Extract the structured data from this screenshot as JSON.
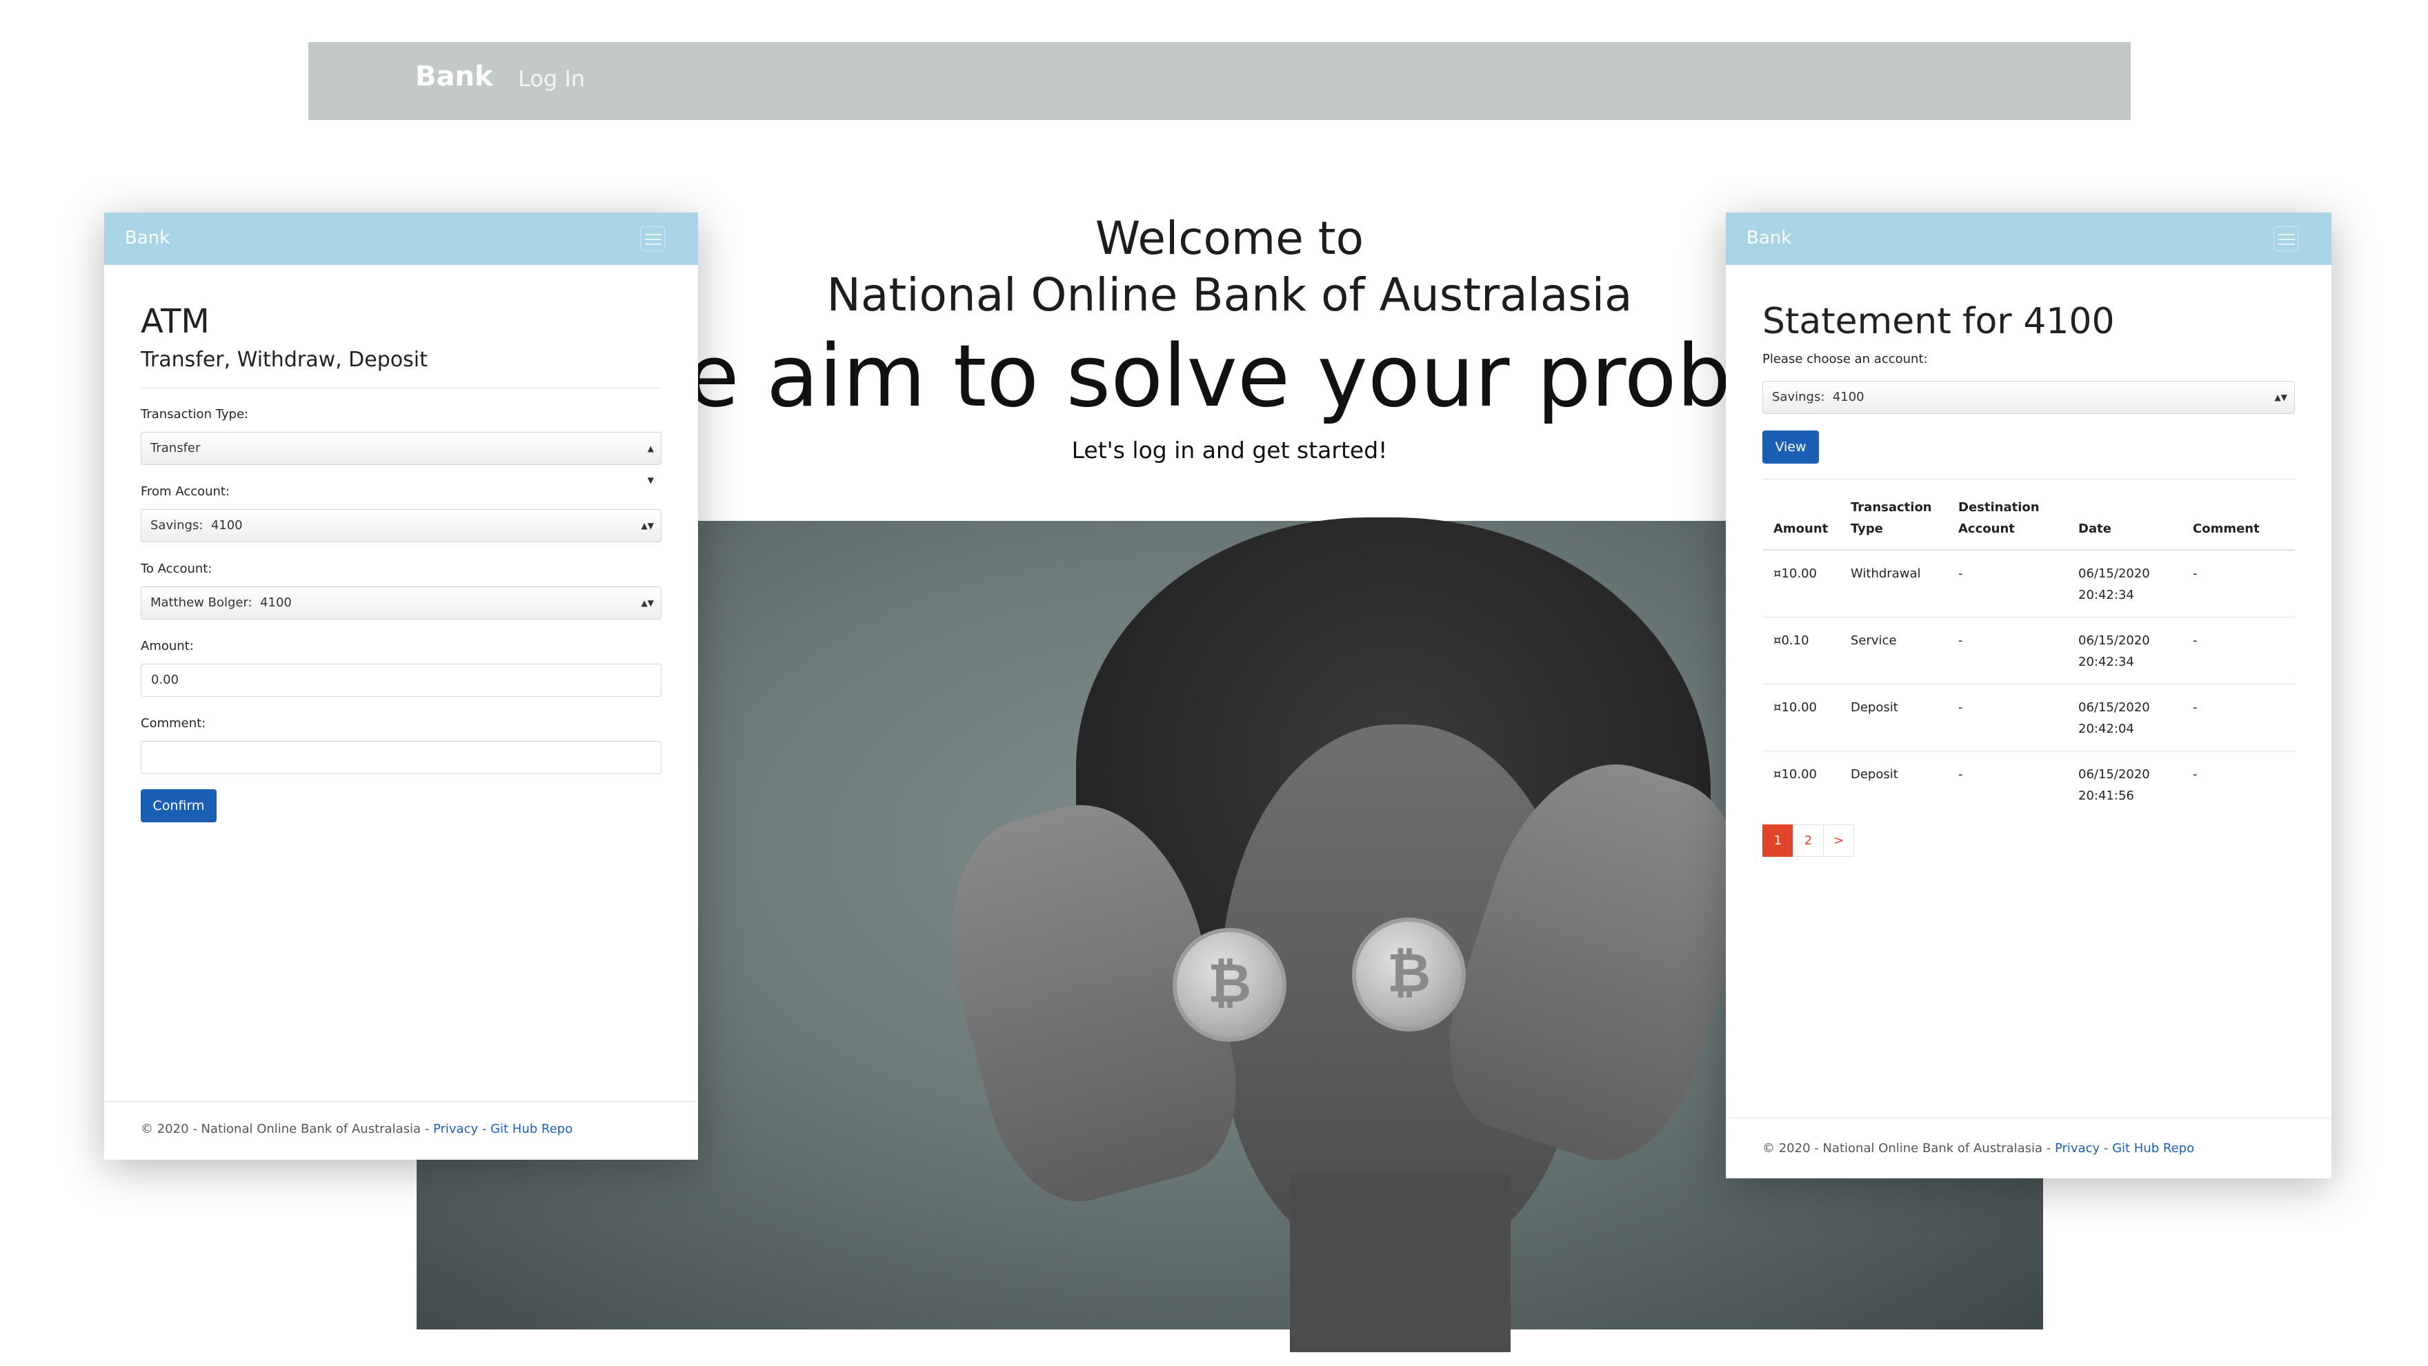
{
  "topnav": {
    "brand": "Bank",
    "login": "Log In"
  },
  "hero": {
    "line1": "Welcome to",
    "line2": "National Online Bank of Australasia",
    "tagline": "We aim to solve your problems",
    "subtitle": "Let's log in and get started!"
  },
  "atm": {
    "nav_brand": "Bank",
    "title": "ATM",
    "subtitle": "Transfer, Withdraw, Deposit",
    "transaction_type_label": "Transaction Type:",
    "transaction_type_value": "Transfer",
    "from_label": "From Account:",
    "from_value": "Savings:  4100",
    "to_label": "To Account:",
    "to_value": "Matthew Bolger:  4100",
    "amount_label": "Amount:",
    "amount_value": "0.00",
    "comment_label": "Comment:",
    "comment_value": "",
    "confirm_label": "Confirm",
    "footer_text": "© 2020 - National Online Bank of Australasia - ",
    "footer_privacy": "Privacy",
    "footer_sep": " - ",
    "footer_repo": "Git Hub Repo"
  },
  "statement": {
    "nav_brand": "Bank",
    "title": "Statement for 4100",
    "prompt": "Please choose an account:",
    "account_value": "Savings:  4100",
    "view_label": "View",
    "headers": [
      "Amount",
      "Transaction Type",
      "Destination Account",
      "Date",
      "Comment"
    ],
    "rows": [
      [
        "¤10.00",
        "Withdrawal",
        "-",
        "06/15/2020 20:42:34",
        "-"
      ],
      [
        "¤0.10",
        "Service",
        "-",
        "06/15/2020 20:42:34",
        "-"
      ],
      [
        "¤10.00",
        "Deposit",
        "-",
        "06/15/2020 20:42:04",
        "-"
      ],
      [
        "¤10.00",
        "Deposit",
        "-",
        "06/15/2020 20:41:56",
        "-"
      ]
    ],
    "pages": [
      "1",
      "2",
      ">"
    ],
    "footer_text": "© 2020 - National Online Bank of Australasia - ",
    "footer_privacy": "Privacy",
    "footer_sep": " - ",
    "footer_repo": "Git Hub Repo"
  },
  "colors": {
    "topnav_bg": "#c3c9c9",
    "phone_nav_bg": "#a8d4e6",
    "primary_button": "#1a5fb4",
    "pager_active": "#e0452b"
  },
  "icons": {
    "hamburger": "hamburger-menu-icon",
    "select_arrow": "select-arrow-icon",
    "coin": "bitcoin-icon"
  }
}
